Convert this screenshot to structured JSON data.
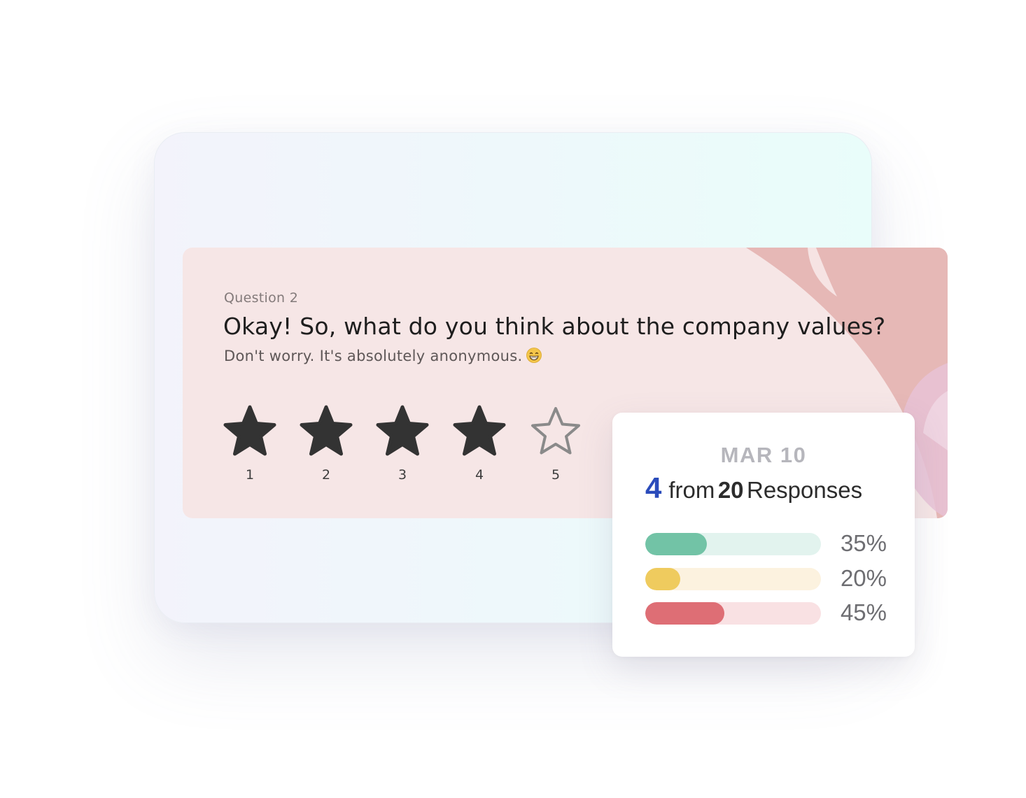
{
  "question": {
    "number_label": "Question 2",
    "title": "Okay! So, what do you think about the company values?",
    "subtitle": "Don't worry. It's absolutely anonymous.",
    "subtitle_emoji": "grinning-face-emoji"
  },
  "rating": {
    "selected": 4,
    "max": 5,
    "stars": [
      {
        "label": "1",
        "filled": true
      },
      {
        "label": "2",
        "filled": true
      },
      {
        "label": "3",
        "filled": true
      },
      {
        "label": "4",
        "filled": true
      },
      {
        "label": "5",
        "filled": false
      }
    ],
    "filled_color": "#333333",
    "empty_color": "#8a8a8a"
  },
  "stats": {
    "date": "MAR 10",
    "value": "4",
    "from_text": "from",
    "count": "20",
    "responses_text": "Responses",
    "bars": [
      {
        "percent_label": "35%",
        "fill_fraction": 0.35,
        "fill_color": "#72c3a6",
        "track_color": "#e2f3ee"
      },
      {
        "percent_label": "20%",
        "fill_fraction": 0.2,
        "fill_color": "#efcb5e",
        "track_color": "#fcf2df"
      },
      {
        "percent_label": "45%",
        "fill_fraction": 0.45,
        "fill_color": "#de6e75",
        "track_color": "#f9e1e3"
      }
    ]
  },
  "colors": {
    "card_background": "#f6e6e6",
    "decoration": "#e6b8b6",
    "accent_blue": "#2a4bbb"
  }
}
